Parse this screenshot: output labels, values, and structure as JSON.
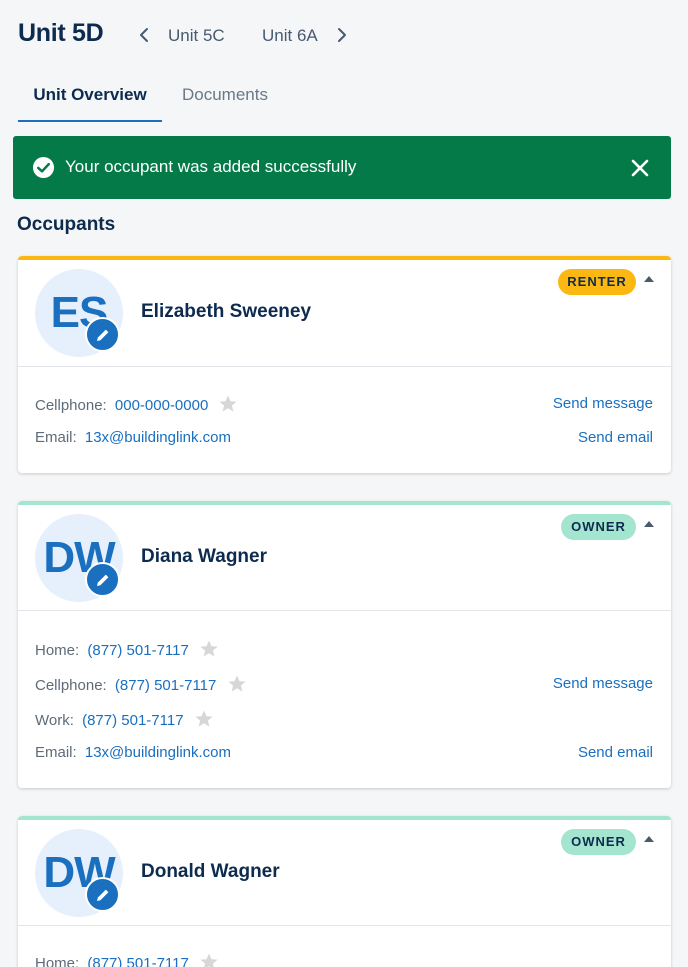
{
  "header": {
    "title": "Unit 5D",
    "prev_unit": "Unit 5C",
    "next_unit": "Unit 6A"
  },
  "tabs": [
    {
      "label": "Unit Overview",
      "active": true
    },
    {
      "label": "Documents",
      "active": false
    }
  ],
  "toast": {
    "message": "Your occupant was added successfully",
    "color": "#047a48"
  },
  "section": {
    "title": "Occupants"
  },
  "colors": {
    "primary": "#1a6fbf",
    "navy": "#0d2b4e",
    "renter": "#fbb813",
    "owner": "#a4e5cf",
    "owner_bar": "#a4e5cf",
    "star": "#d7d7d7"
  },
  "occupants": [
    {
      "initials": "ES",
      "name": "Elizabeth Sweeney",
      "role": "RENTER",
      "phones": [
        {
          "label": "Cellphone:",
          "value": "000-000-0000"
        }
      ],
      "email_label": "Email:",
      "email": "13x@buildinglink.com",
      "send_message": "Send message",
      "send_email": "Send email"
    },
    {
      "initials": "DW",
      "name": "Diana Wagner",
      "role": "OWNER",
      "phones": [
        {
          "label": "Home:",
          "value": "(877) 501-7117"
        },
        {
          "label": "Cellphone:",
          "value": "(877) 501-7117"
        },
        {
          "label": "Work:",
          "value": "(877) 501-7117"
        }
      ],
      "email_label": "Email:",
      "email": "13x@buildinglink.com",
      "send_message": "Send message",
      "send_email": "Send email"
    },
    {
      "initials": "DW",
      "name": "Donald Wagner",
      "role": "OWNER",
      "phones": [
        {
          "label": "Home:",
          "value": "(877) 501-7117"
        }
      ]
    }
  ]
}
